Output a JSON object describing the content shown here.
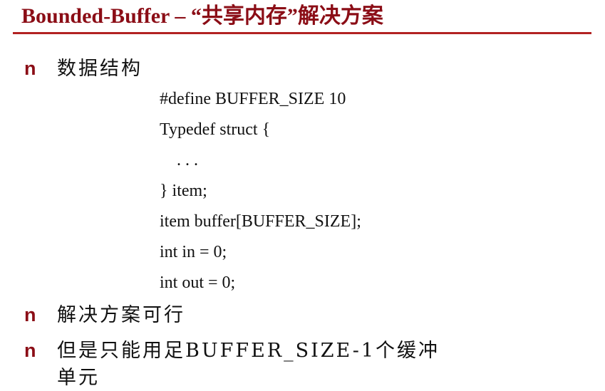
{
  "title": "Bounded-Buffer – “共享内存”解决方案",
  "bullets": [
    {
      "marker": "n",
      "text": "数据结构"
    },
    {
      "marker": "n",
      "text": "解决方案可行"
    },
    {
      "marker": "n",
      "text": "但是只能用足BUFFER_SIZE-1个缓冲",
      "continuation": "单元"
    }
  ],
  "code_lines": [
    "#define BUFFER_SIZE 10",
    "Typedef struct {",
    "    . . .",
    "} item;",
    "item buffer[BUFFER_SIZE];",
    "int in = 0;",
    "int out = 0;"
  ]
}
